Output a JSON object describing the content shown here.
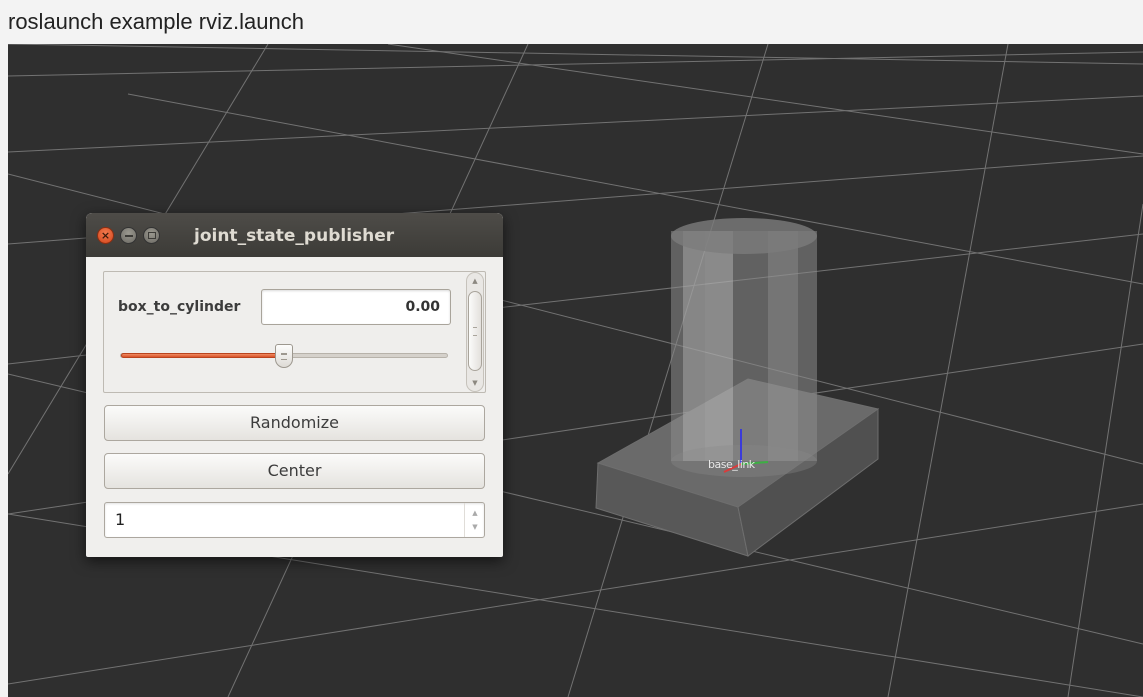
{
  "caption": "roslaunch example rviz.launch",
  "viewport": {
    "tf_label": "base_link"
  },
  "window": {
    "title": "joint_state_publisher",
    "controls": {
      "close": "×",
      "minimize": "",
      "maximize": ""
    }
  },
  "joint": {
    "name": "box_to_cylinder",
    "value": "0.00",
    "slider_fraction": 0.5
  },
  "buttons": {
    "randomize": "Randomize",
    "center": "Center"
  },
  "spinbox": {
    "value": "1"
  },
  "colors": {
    "accent": "#e0592e",
    "viewport_bg": "#2f2f2f",
    "titlebar": "#3c3b37"
  }
}
